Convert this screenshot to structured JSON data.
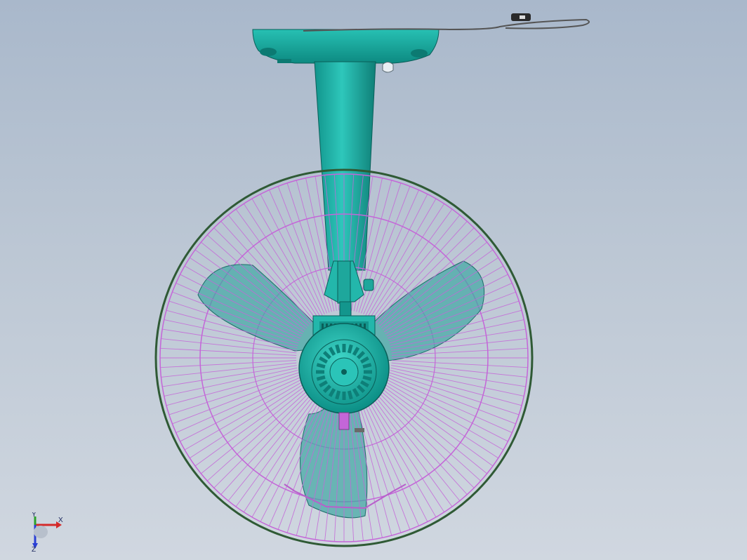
{
  "viewport": {
    "background_top": "#a9b8cb",
    "background_bottom": "#d0d7e0"
  },
  "model": {
    "body_color": "#1fb5aa",
    "body_dark": "#0e7f78",
    "guard_color": "#c466d8",
    "rim_color": "#2f5a35",
    "blade_color": "#3fa7a2"
  },
  "triad": {
    "x_label": "X",
    "y_label": "Y",
    "z_label": "Z",
    "x_color": "#d42a2a",
    "y_color": "#2aa12a",
    "z_color": "#2a3fd4"
  }
}
